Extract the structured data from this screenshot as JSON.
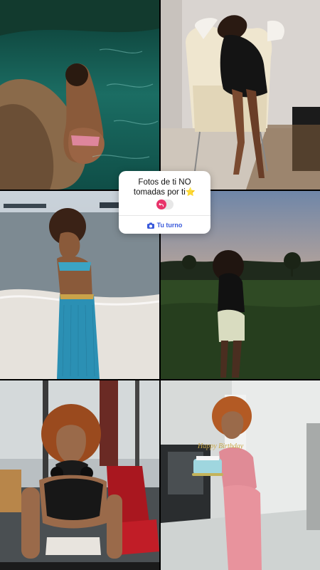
{
  "sticker": {
    "prompt": "Fotos de ti NO tomadas por ti⭐",
    "cta_label": "Tu turno",
    "accent_color": "#e8336a",
    "cta_color": "#3b5bdb"
  },
  "photos": [
    {
      "name": "photo-rocks-water",
      "description_icon": "photo"
    },
    {
      "name": "photo-white-chair",
      "description_icon": "photo"
    },
    {
      "name": "photo-beach",
      "description_icon": "photo"
    },
    {
      "name": "photo-sunset-field",
      "description_icon": "photo"
    },
    {
      "name": "photo-gym",
      "description_icon": "photo"
    },
    {
      "name": "photo-birthday-cake",
      "description_icon": "photo"
    }
  ],
  "cake_topper_text": "Happy Birthday"
}
